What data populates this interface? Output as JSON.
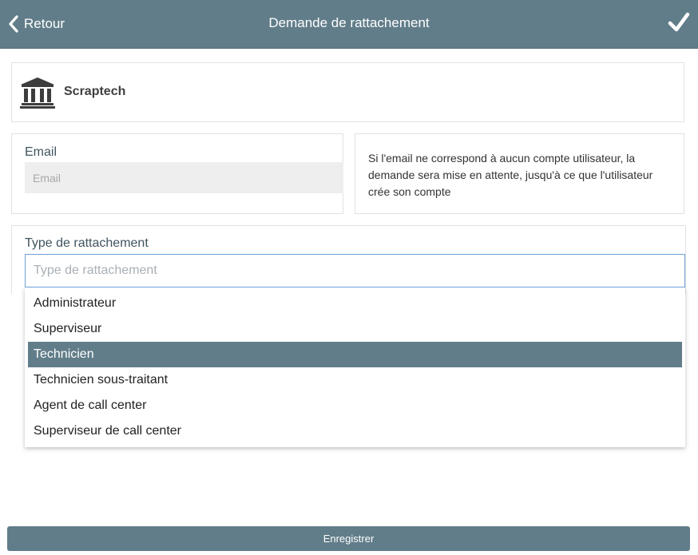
{
  "header": {
    "back_label": "Retour",
    "title": "Demande de rattachement",
    "confirm_icon": "checkmark-icon",
    "back_icon": "chevron-left-icon",
    "color": "#617d89"
  },
  "organization": {
    "icon": "bank-building-icon",
    "name": "Scraptech"
  },
  "email": {
    "label": "Email",
    "placeholder": "Email",
    "value": ""
  },
  "info": {
    "text": "Si l'email ne correspond à aucun compte utilisateur, la demande sera mise en attente, jusqu'à ce que l'utilisateur crée son compte"
  },
  "attachment_type": {
    "label": "Type de rattachement",
    "placeholder": "Type de rattachement",
    "value": "",
    "options": [
      "Administrateur",
      "Superviseur",
      "Technicien",
      "Technicien sous-traitant",
      "Agent de call center",
      "Superviseur de call center"
    ],
    "highlighted_option": "Technicien"
  },
  "footer": {
    "save_label": "Enregistrer"
  }
}
